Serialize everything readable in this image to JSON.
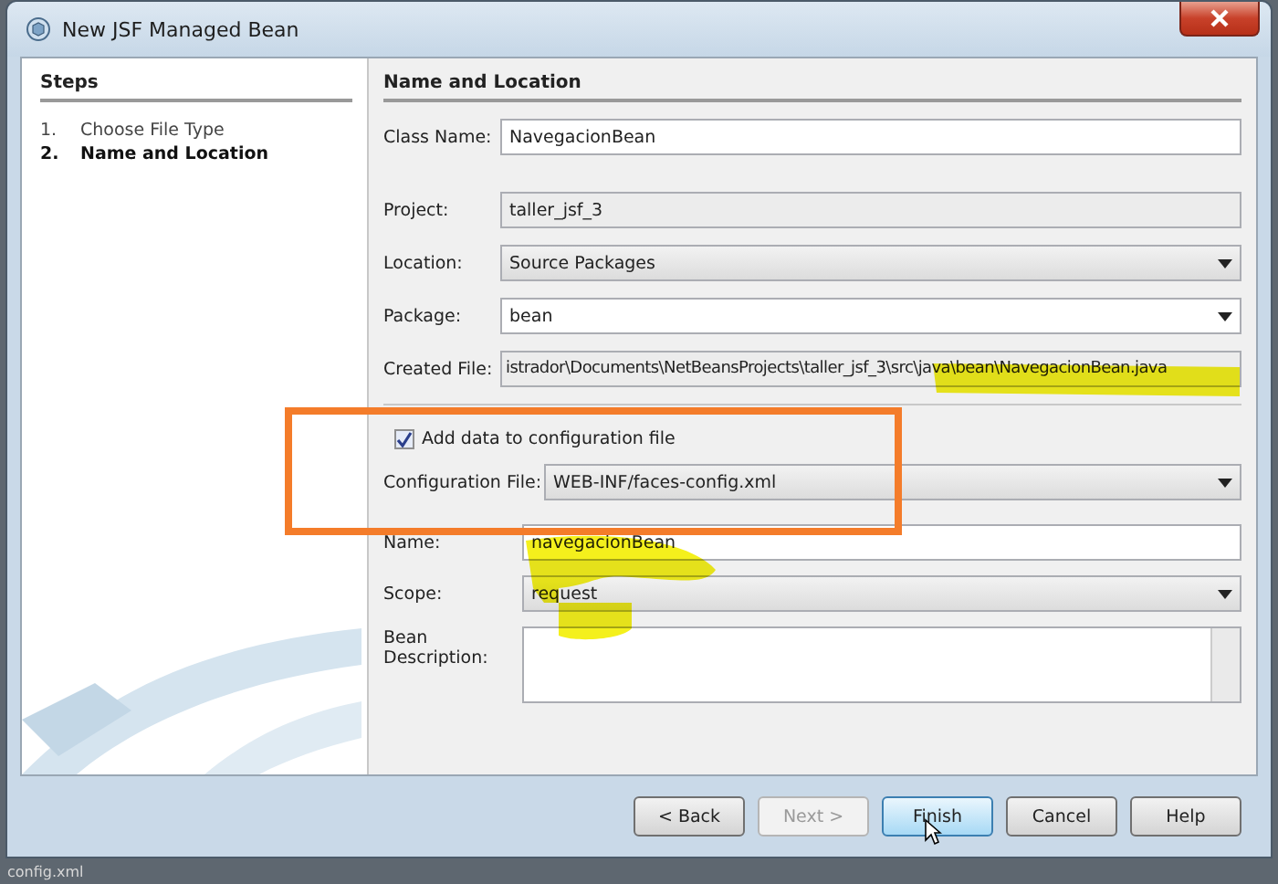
{
  "window": {
    "title": "New JSF Managed Bean"
  },
  "steps": {
    "heading": "Steps",
    "items": [
      {
        "number": "1.",
        "label": "Choose File Type",
        "selected": false
      },
      {
        "number": "2.",
        "label": "Name and Location",
        "selected": true
      }
    ]
  },
  "panel": {
    "heading": "Name and Location",
    "class_name": {
      "label": "Class Name:",
      "value": "NavegacionBean"
    },
    "project": {
      "label": "Project:",
      "value": "taller_jsf_3"
    },
    "location": {
      "label": "Location:",
      "value": "Source Packages"
    },
    "package": {
      "label": "Package:",
      "value": "bean"
    },
    "created_file": {
      "label": "Created File:",
      "value": "istrador\\Documents\\NetBeansProjects\\taller_jsf_3\\src\\java\\bean\\NavegacionBean.java"
    },
    "add_to_config": {
      "label": "Add data to configuration file",
      "checked": true
    },
    "configuration_file": {
      "label": "Configuration File:",
      "value": "WEB-INF/faces-config.xml"
    },
    "name": {
      "label": "Name:",
      "value": "navegacionBean"
    },
    "scope": {
      "label": "Scope:",
      "value": "request"
    },
    "bean_description": {
      "label": "Bean Description:"
    }
  },
  "buttons": [
    {
      "label": "< Back",
      "disabled": false,
      "focused": false
    },
    {
      "label": "Next >",
      "disabled": true,
      "focused": false
    },
    {
      "label": "Finish",
      "disabled": false,
      "focused": true
    },
    {
      "label": "Cancel",
      "disabled": false,
      "focused": false
    },
    {
      "label": "Help",
      "disabled": false,
      "focused": false
    }
  ],
  "background_text": "config.xml"
}
